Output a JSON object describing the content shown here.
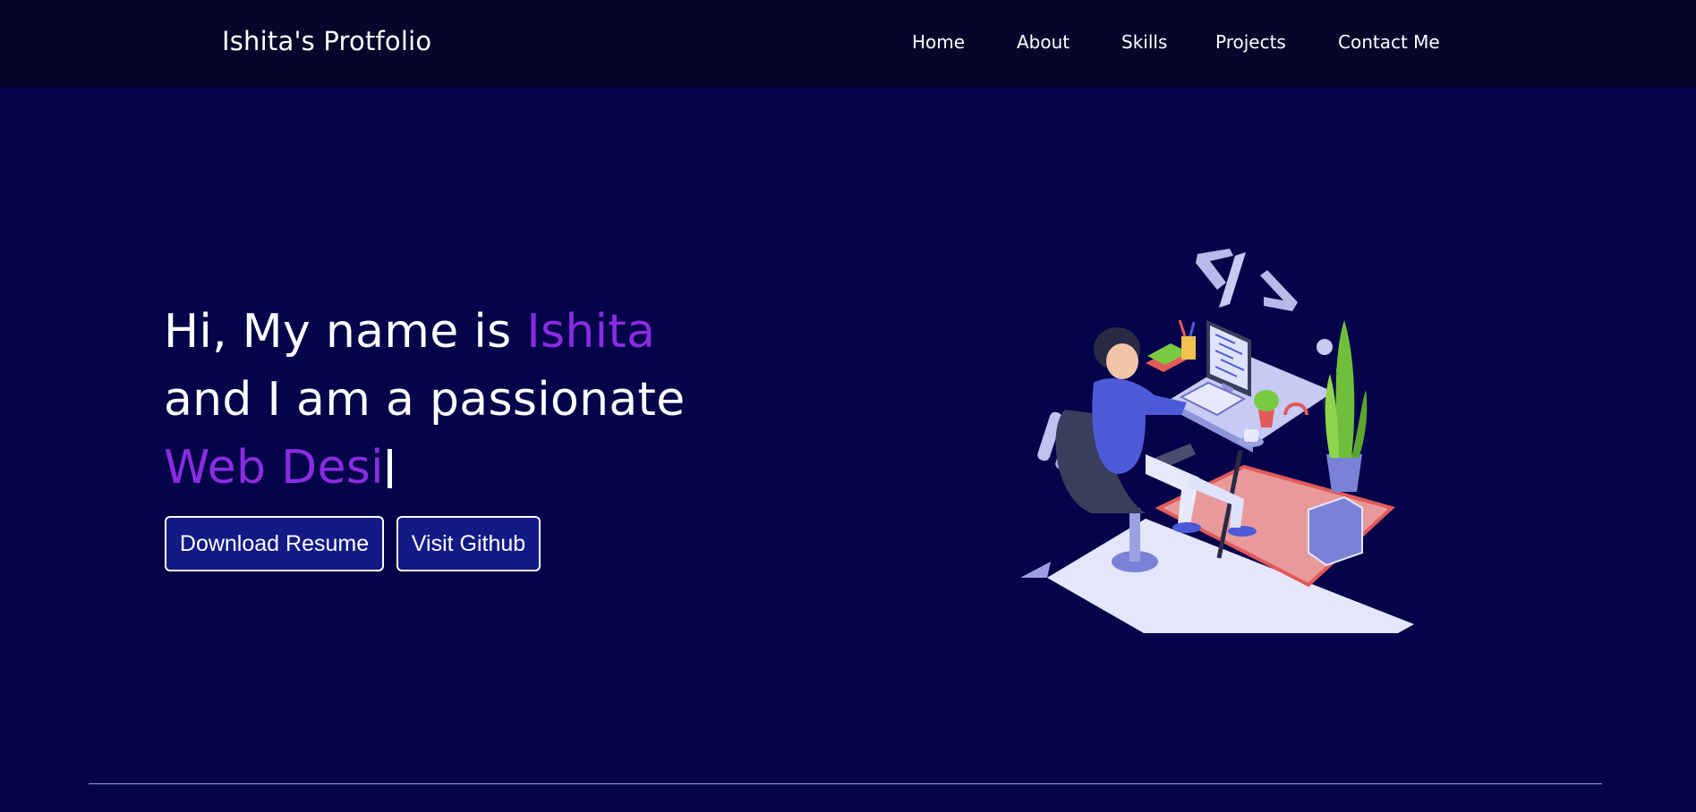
{
  "navbar": {
    "brand": "Ishita's Protfolio",
    "items": [
      {
        "label": "Home"
      },
      {
        "label": "About"
      },
      {
        "label": "Skills"
      },
      {
        "label": "Projects"
      },
      {
        "label": "Contact Me"
      }
    ]
  },
  "hero": {
    "line1_prefix": "Hi, My name is ",
    "name": "Ishita",
    "line2": "and I am a passionate",
    "typed_role": "Web Desi"
  },
  "buttons": {
    "resume": "Download Resume",
    "github": "Visit Github"
  },
  "illustration": {
    "code_symbol": "</>"
  },
  "colors": {
    "background": "#05044a",
    "navbar": "#06062a",
    "accent": "#8a2be2",
    "button_bg": "#131a85"
  }
}
